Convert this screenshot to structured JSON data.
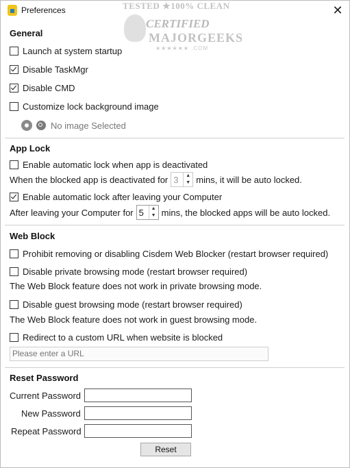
{
  "window": {
    "title": "Preferences",
    "close_glyph": "✕",
    "app_icon": "lock-app-icon"
  },
  "watermark": {
    "line1": "TESTED ★100% CLEAN",
    "line2": "CERTIFIED",
    "line3": "MAJORGEEKS",
    "line4": "★★★★★★ .COM"
  },
  "general": {
    "heading": "General",
    "launch_startup": {
      "label": "Launch at system startup",
      "checked": false
    },
    "disable_taskmgr": {
      "label": "Disable TaskMgr",
      "checked": true
    },
    "disable_cmd": {
      "label": "Disable CMD",
      "checked": true
    },
    "customize_bg": {
      "label": "Customize lock background image",
      "checked": false
    },
    "image_status": "No image Selected"
  },
  "app_lock": {
    "heading": "App Lock",
    "auto_lock_deactivated": {
      "label": "Enable automatic lock when app is deactivated",
      "checked": false
    },
    "deactivated_pre": "When the blocked app is deactivated for",
    "deactivated_value": "3",
    "deactivated_post": "mins, it will be auto locked.",
    "auto_lock_leaving": {
      "label": "Enable automatic lock after leaving your Computer",
      "checked": true
    },
    "leaving_pre": "After leaving your Computer for",
    "leaving_value": "5",
    "leaving_post": "mins, the blocked apps will be auto locked."
  },
  "web_block": {
    "heading": "Web Block",
    "prohibit_removing": {
      "label": "Prohibit removing or disabling Cisdem Web Blocker (restart browser required)",
      "checked": false
    },
    "disable_private": {
      "label": "Disable private browsing mode (restart browser required)",
      "checked": false
    },
    "private_note": "The Web Block feature does not work in private browsing mode.",
    "disable_guest": {
      "label": "Disable guest browsing mode (restart browser required)",
      "checked": false
    },
    "guest_note": "The Web Block feature does not work in guest browsing mode.",
    "redirect": {
      "label": "Redirect to a custom URL when website is blocked",
      "checked": false
    },
    "url_placeholder": "Please enter a URL"
  },
  "reset_password": {
    "heading": "Reset Password",
    "current_label": "Current Password",
    "new_label": "New Password",
    "repeat_label": "Repeat Password",
    "reset_button": "Reset"
  }
}
